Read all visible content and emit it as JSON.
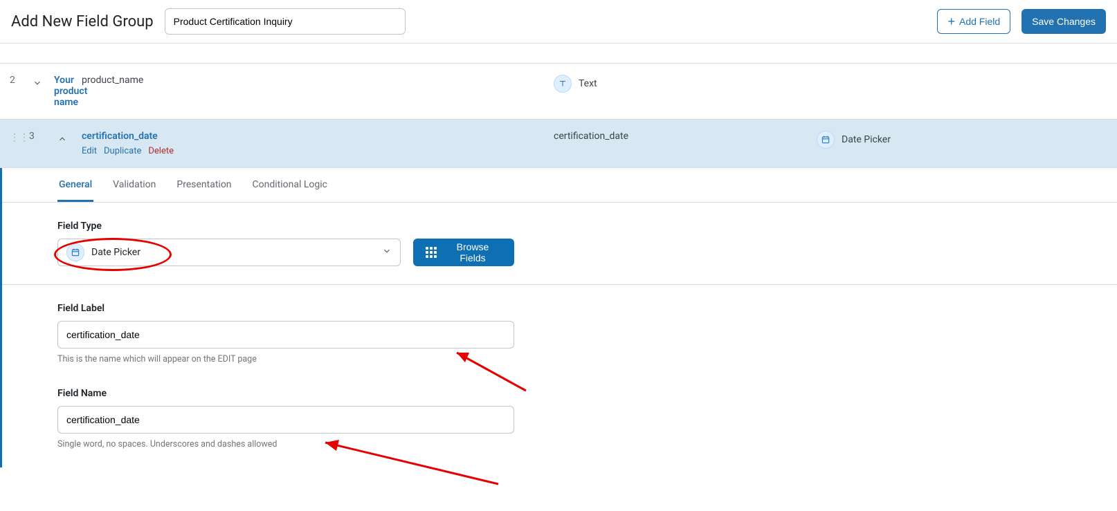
{
  "header": {
    "title": "Add New Field Group",
    "group_name": "Product Certification Inquiry",
    "add_field": "Add Field",
    "save": "Save Changes"
  },
  "rows": {
    "r2": {
      "num": "2",
      "label": "Your product name",
      "key": "product_name",
      "type": "Text"
    },
    "r3": {
      "num": "3",
      "label": "certification_date",
      "key": "certification_date",
      "type": "Date Picker"
    }
  },
  "row_actions": {
    "edit": "Edit",
    "duplicate": "Duplicate",
    "delete": "Delete"
  },
  "tabs": {
    "general": "General",
    "validation": "Validation",
    "presentation": "Presentation",
    "conditional": "Conditional Logic"
  },
  "editor": {
    "field_type": {
      "label": "Field Type",
      "value": "Date Picker",
      "browse": "Browse Fields"
    },
    "field_label": {
      "label": "Field Label",
      "value": "certification_date",
      "hint": "This is the name which will appear on the EDIT page"
    },
    "field_name": {
      "label": "Field Name",
      "value": "certification_date",
      "hint": "Single word, no spaces. Underscores and dashes allowed"
    }
  }
}
